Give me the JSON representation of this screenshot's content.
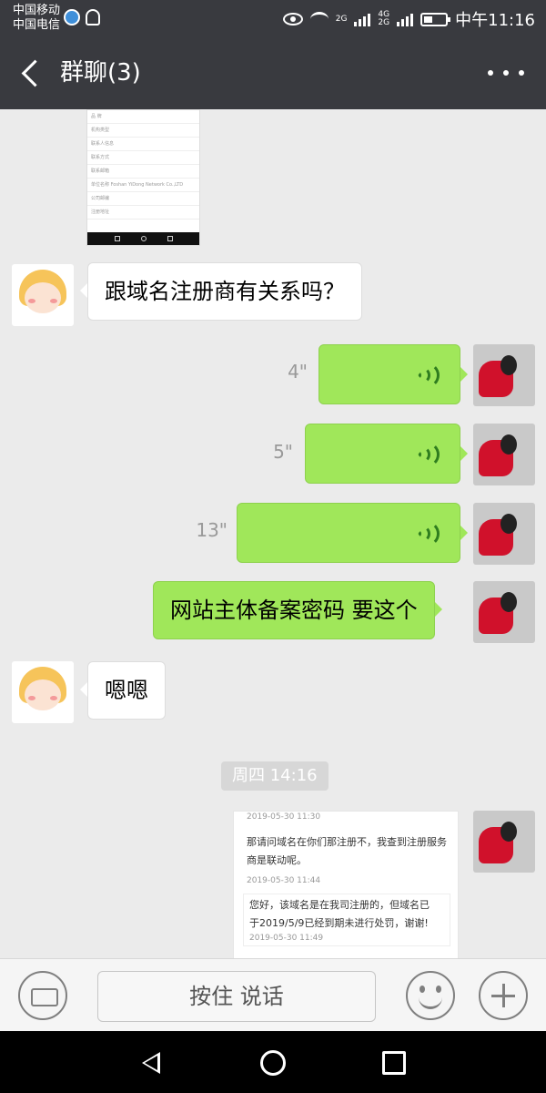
{
  "status_bar": {
    "carrier_1": "中国移动",
    "carrier_2": "中国电信",
    "network_1": "2G",
    "network_2": "4G",
    "network_3": "2G",
    "time": "中午11:16"
  },
  "header": {
    "title": "群聊(3)"
  },
  "top_image": {
    "rows": [
      "品  牌",
      "机构类型",
      "联系人信息",
      "联系方式",
      "联系邮箱",
      "单位名称  Foshan YiDong Network Co.,LTD",
      "公司邮编",
      "注册地址"
    ]
  },
  "messages": [
    {
      "type": "text",
      "side": "left",
      "text": "跟域名注册商有关系吗？"
    },
    {
      "type": "voice",
      "side": "right",
      "duration": "4\""
    },
    {
      "type": "voice",
      "side": "right",
      "duration": "5\""
    },
    {
      "type": "voice",
      "side": "right",
      "duration": "13\""
    },
    {
      "type": "text",
      "side": "right",
      "text": "网站主体备案密码 要这个"
    },
    {
      "type": "text",
      "side": "left",
      "text": "嗯嗯"
    }
  ],
  "time_label": "周四 14:16",
  "bottom_image": {
    "ts1": "2019-05-30 11:30",
    "text1": "那请问域名在你们那注册不，我查到注册服务商是联动呢。",
    "ts2": "2019-05-30 11:44",
    "text2": "您好，该域名是在我司注册的，但域名已于2019/5/9已经到期未进行处罚，谢谢!",
    "ts3": "2019-05-30 11:49"
  },
  "input_bar": {
    "hold_to_talk": "按住 说话"
  },
  "colors": {
    "header_bg": "#393a3f",
    "chat_bg": "#ebebeb",
    "my_bubble": "#a0e75a",
    "their_bubble": "#ffffff"
  },
  "icons": [
    "back-icon",
    "more-icon",
    "voice-wave-icon",
    "keyboard-icon",
    "emoji-icon",
    "plus-icon",
    "nav-back-icon",
    "nav-home-icon",
    "nav-recent-icon"
  ]
}
